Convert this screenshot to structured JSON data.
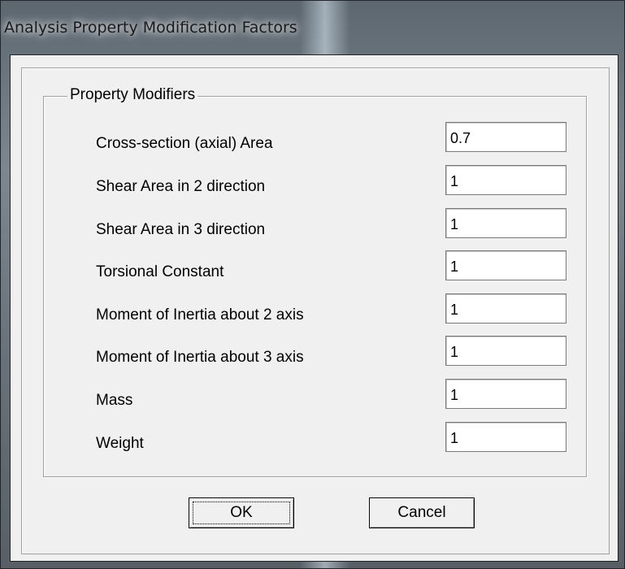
{
  "window": {
    "title": "Analysis Property Modification Factors"
  },
  "group": {
    "label": "Property Modifiers"
  },
  "modifiers": [
    {
      "label": "Cross-section (axial) Area",
      "value": "0.7"
    },
    {
      "label": "Shear Area in 2 direction",
      "value": "1"
    },
    {
      "label": "Shear Area in 3 direction",
      "value": "1"
    },
    {
      "label": "Torsional Constant",
      "value": "1"
    },
    {
      "label": "Moment of Inertia about 2 axis",
      "value": "1"
    },
    {
      "label": "Moment of Inertia about 3 axis",
      "value": "1"
    },
    {
      "label": "Mass",
      "value": "1"
    },
    {
      "label": "Weight",
      "value": "1"
    }
  ],
  "buttons": {
    "ok_label": "OK",
    "cancel_label": "Cancel"
  }
}
